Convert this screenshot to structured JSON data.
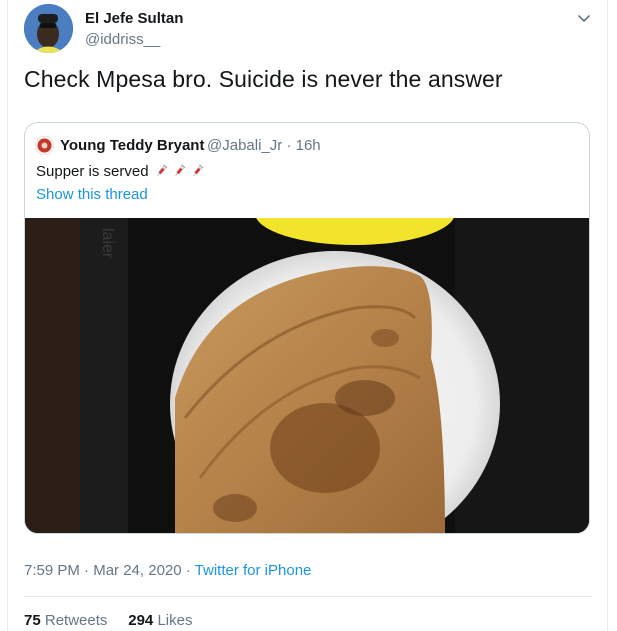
{
  "author": {
    "name": "El Jefe Sultan",
    "handle": "@iddriss__"
  },
  "tweet": {
    "text": "Check Mpesa bro. Suicide is never the answer"
  },
  "quoted": {
    "name": "Young Teddy Bryant",
    "handle": "@Jabali_Jr",
    "time": "· 16h",
    "text": "Supper is served",
    "emoji": [
      "syringe-icon",
      "syringe-icon",
      "syringe-icon"
    ],
    "show_thread": "Show this thread",
    "photo": "chapati-on-white-plate"
  },
  "meta": {
    "time": "7:59 PM",
    "date": "Mar 24, 2020",
    "source": "Twitter for iPhone",
    "dot": " · "
  },
  "stats": {
    "retweets_count": "75",
    "retweets_label": "Retweets",
    "likes_count": "294",
    "likes_label": "Likes"
  },
  "colors": {
    "link": "#1b95e0",
    "secondary": "#657786",
    "border": "#ccd6dd"
  }
}
